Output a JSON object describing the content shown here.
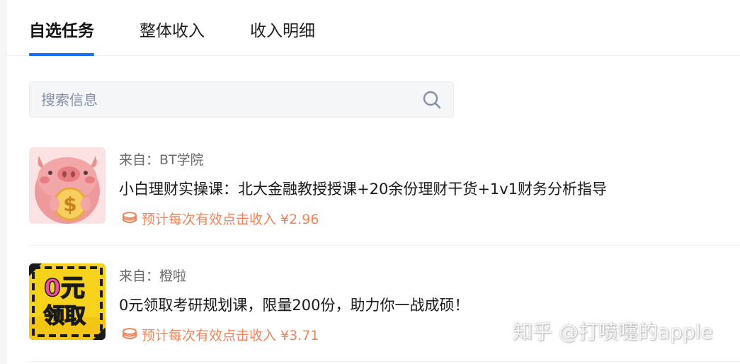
{
  "tabs": [
    {
      "label": "自选任务",
      "active": true
    },
    {
      "label": "整体收入",
      "active": false
    },
    {
      "label": "收入明细",
      "active": false
    }
  ],
  "search": {
    "placeholder": "搜索信息",
    "value": ""
  },
  "tasks": [
    {
      "source": "来自：BT学院",
      "title": "小白理财实操课：北大金融教授授课+20余份理财干货+1v1财务分析指导",
      "income_text": "预计每次有效点击收入 ¥2.96",
      "thumb_icon": "piggy-bank-icon"
    },
    {
      "source": "来自：橙啦",
      "title": "0元领取考研规划课，限量200份，助力你一战成硕！",
      "income_text": "预计每次有效点击收入 ¥3.71",
      "thumb_icon": "free-course-badge-icon",
      "thumb_text": "0元领取"
    }
  ],
  "colors": {
    "accent": "#1772f6",
    "income": "#f0835a",
    "piggy_bg": "#fbe3e3",
    "badge_yellow": "#f7d21c"
  },
  "watermark": "知乎 @打喷嚏的apple"
}
